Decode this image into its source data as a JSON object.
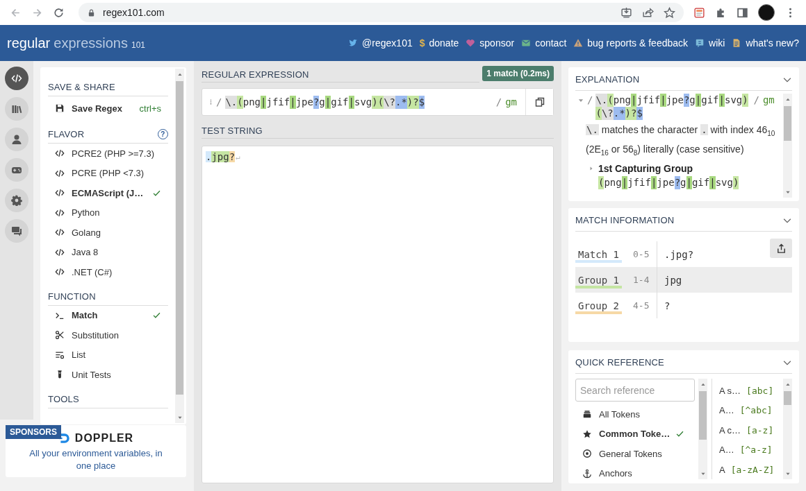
{
  "browser": {
    "url": "regex101.com"
  },
  "header": {
    "logo": {
      "primary": "regular",
      "secondary": "expressions",
      "suffix": "101"
    },
    "links": [
      {
        "kind": "bird",
        "label": "@regex101"
      },
      {
        "kind": "dollar",
        "symbol": "$",
        "label": "donate"
      },
      {
        "kind": "heart",
        "label": "sponsor"
      },
      {
        "kind": "envelope",
        "label": "contact"
      },
      {
        "kind": "warning",
        "label": "bug reports & feedback"
      },
      {
        "kind": "wiki",
        "label": "wiki"
      },
      {
        "kind": "document",
        "label": "what's new?"
      }
    ]
  },
  "rail": [
    {
      "kind": "code",
      "selected": true
    },
    {
      "kind": "library",
      "selected": false
    },
    {
      "kind": "user",
      "selected": false
    },
    {
      "kind": "gamepad",
      "selected": false
    },
    {
      "kind": "gear",
      "selected": false
    },
    {
      "kind": "chat",
      "selected": false
    }
  ],
  "sidebar": {
    "save_share": {
      "title": "SAVE & SHARE",
      "label": "Save Regex",
      "shortcut": "ctrl+s"
    },
    "flavor": {
      "title": "FLAVOR",
      "help": "?",
      "items": [
        {
          "label": "PCRE2 (PHP >=7.3)",
          "selected": false
        },
        {
          "label": "PCRE (PHP <7.3)",
          "selected": false
        },
        {
          "label": "ECMAScript (J…",
          "selected": true
        },
        {
          "label": "Python",
          "selected": false
        },
        {
          "label": "Golang",
          "selected": false
        },
        {
          "label": "Java 8",
          "selected": false
        },
        {
          "label": ".NET (C#)",
          "selected": false
        }
      ]
    },
    "function": {
      "title": "FUNCTION",
      "items": [
        {
          "kind": "prompt",
          "label": "Match",
          "selected": true
        },
        {
          "kind": "scissors",
          "label": "Substitution",
          "selected": false
        },
        {
          "kind": "list",
          "label": "List",
          "selected": false
        },
        {
          "kind": "flask",
          "label": "Unit Tests",
          "selected": false
        }
      ]
    },
    "tools": {
      "title": "TOOLS"
    }
  },
  "sponsor": {
    "badge": "SPONSORS",
    "brand": "DOPPLER",
    "tagline": "All your environment variables, in one place"
  },
  "regex": {
    "title": "REGULAR EXPRESSION",
    "status": "1 match (0.2ms)",
    "open": "/",
    "close": "/",
    "flags": "gm",
    "tokens": [
      {
        "text": "\\.",
        "kind": "escape"
      },
      {
        "text": "(",
        "kind": "group"
      },
      {
        "text": "png",
        "kind": "plain"
      },
      {
        "text": "|",
        "kind": "alt"
      },
      {
        "text": "jfif",
        "kind": "plain"
      },
      {
        "text": "|",
        "kind": "alt"
      },
      {
        "text": "jpe",
        "kind": "plain"
      },
      {
        "text": "?",
        "kind": "quant"
      },
      {
        "text": "g",
        "kind": "plain"
      },
      {
        "text": "|",
        "kind": "alt"
      },
      {
        "text": "gif",
        "kind": "plain"
      },
      {
        "text": "|",
        "kind": "alt"
      },
      {
        "text": "svg",
        "kind": "plain"
      },
      {
        "text": ")",
        "kind": "group"
      },
      {
        "text": "(",
        "kind": "group"
      },
      {
        "text": "\\?",
        "kind": "escape"
      },
      {
        "text": ".*",
        "kind": "quant"
      },
      {
        "text": ")?",
        "kind": "group"
      },
      {
        "text": "$",
        "kind": "quant"
      }
    ]
  },
  "test_string": {
    "title": "TEST STRING",
    "line_end": "↵",
    "segments": [
      {
        "text": ".",
        "kind": "match"
      },
      {
        "text": "jpg",
        "kind": "group1"
      },
      {
        "text": "?",
        "kind": "group2"
      }
    ]
  },
  "explanation": {
    "title": "EXPLANATION",
    "root": {
      "expanded": true,
      "open": "/",
      "close": "/",
      "flags": "gm",
      "tokens": [
        {
          "text": "\\.",
          "kind": "escape"
        },
        {
          "text": "(",
          "kind": "group"
        },
        {
          "text": "png",
          "kind": "plain"
        },
        {
          "text": "|",
          "kind": "alt"
        },
        {
          "text": "jfif",
          "kind": "plain"
        },
        {
          "text": "|",
          "kind": "alt"
        },
        {
          "text": "jpe",
          "kind": "plain"
        },
        {
          "text": "?",
          "kind": "quant"
        },
        {
          "text": "g",
          "kind": "plain"
        },
        {
          "text": "|",
          "kind": "alt"
        },
        {
          "text": "gif",
          "kind": "plain"
        },
        {
          "text": "|",
          "kind": "alt"
        },
        {
          "text": "svg",
          "kind": "plain"
        },
        {
          "text": ")",
          "kind": "group"
        },
        {
          "text": "(",
          "kind": "group"
        },
        {
          "text": "\\?",
          "kind": "escape"
        },
        {
          "text": ".*",
          "kind": "quant"
        },
        {
          "text": ")?",
          "kind": "group"
        },
        {
          "text": "$",
          "kind": "quant"
        }
      ]
    },
    "description": [
      {
        "kind": "code",
        "text": "\\."
      },
      {
        "kind": "text",
        "text": " matches the character "
      },
      {
        "kind": "code",
        "text": "."
      },
      {
        "kind": "text",
        "text": " with index 46$_{10}$ (2E$_{16}$ or 56$_{8}$) literally (case sensitive)"
      }
    ],
    "groups": [
      {
        "title": "1st Capturing Group",
        "expanded": false,
        "tokens": [
          {
            "text": "(",
            "kind": "group"
          },
          {
            "text": "png",
            "kind": "plain"
          },
          {
            "text": "|",
            "kind": "alt"
          },
          {
            "text": "jfif",
            "kind": "plain"
          },
          {
            "text": "|",
            "kind": "alt"
          },
          {
            "text": "jpe",
            "kind": "plain"
          },
          {
            "text": "?",
            "kind": "quant"
          },
          {
            "text": "g",
            "kind": "plain"
          },
          {
            "text": "|",
            "kind": "alt"
          },
          {
            "text": "gif",
            "kind": "plain"
          },
          {
            "text": "|",
            "kind": "alt"
          },
          {
            "text": "svg",
            "kind": "plain"
          },
          {
            "text": ")",
            "kind": "group"
          }
        ]
      }
    ]
  },
  "match_information": {
    "title": "MATCH INFORMATION",
    "rows": [
      {
        "label": "Match 1",
        "range": "0-5",
        "value": ".jpg?",
        "color": "#d4e9fb",
        "selected": false
      },
      {
        "label": "Group 1",
        "range": "1-4",
        "value": "jpg",
        "color": "#c5e5a3",
        "selected": true
      },
      {
        "label": "Group 2",
        "range": "4-5",
        "value": "?",
        "color": "#f6d9a6",
        "selected": false
      }
    ]
  },
  "quick_reference": {
    "title": "QUICK REFERENCE",
    "placeholder": "Search reference",
    "categories": [
      {
        "kind": "stack",
        "label": "All Tokens",
        "selected": false
      },
      {
        "kind": "star",
        "label": "Common Toke…",
        "selected": true
      },
      {
        "kind": "target",
        "label": "General Tokens",
        "selected": false
      },
      {
        "kind": "anchor",
        "label": "Anchors",
        "selected": false
      }
    ],
    "tokens": [
      {
        "description": "A s…",
        "token": "[abc]"
      },
      {
        "description": "A…",
        "token": "[^abc]"
      },
      {
        "description": "A c…",
        "token": "[a-z]"
      },
      {
        "description": "A…",
        "token": "[^a-z]"
      },
      {
        "description": "A",
        "token": "[a-zA-Z]"
      }
    ]
  }
}
